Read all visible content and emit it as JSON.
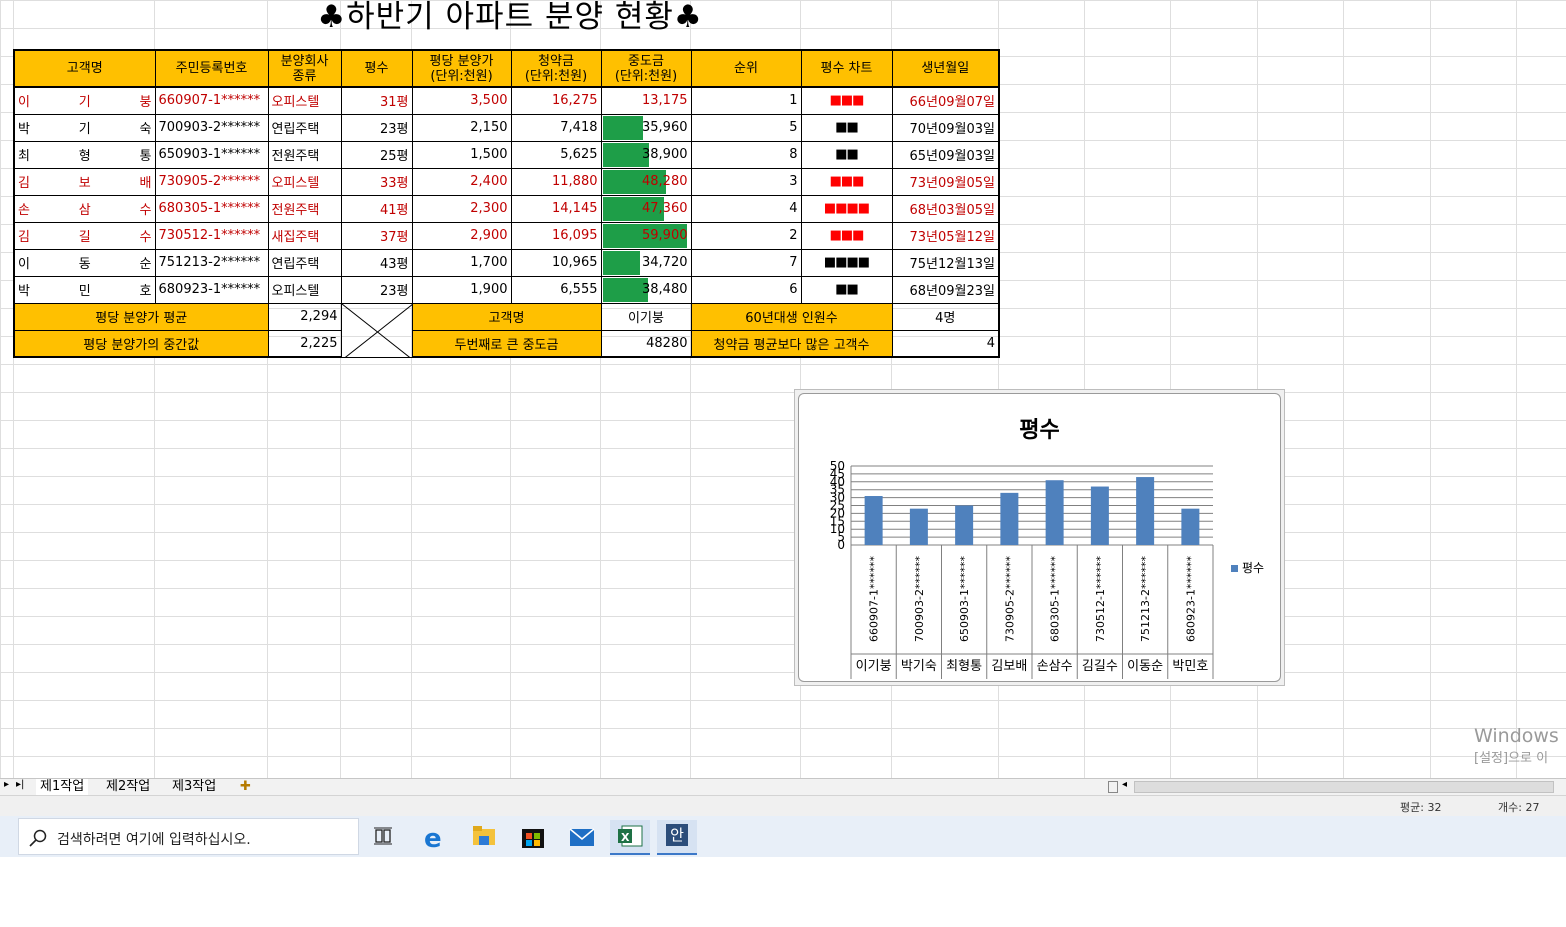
{
  "title": "♣하반기 아파트 분양 현황♣",
  "headers": [
    "고객명",
    "주민등록번호",
    "분양회사\n종류",
    "평수",
    "평당 분양가\n(단위:천원)",
    "청약금\n(단위:천원)",
    "중도금\n(단위:천원)",
    "순위",
    "평수 차트",
    "생년월일"
  ],
  "rows": [
    {
      "name": "이 기 붕",
      "id": "660907-1******",
      "type": "오피스텔",
      "size": "31평",
      "price": "3,500",
      "deposit": "16,275",
      "mid": "13,175",
      "mid_fill": 0.0,
      "rank": "1",
      "chart": "■■■",
      "birth": "66년09월07일",
      "red": true
    },
    {
      "name": "박 기 숙",
      "id": "700903-2******",
      "type": "연립주택",
      "size": "23평",
      "price": "2,150",
      "deposit": "7,418",
      "mid": "35,960",
      "mid_fill": 0.46,
      "rank": "5",
      "chart": "■■",
      "birth": "70년09월03일",
      "red": false
    },
    {
      "name": "최 형 통",
      "id": "650903-1******",
      "type": "전원주택",
      "size": "25평",
      "price": "1,500",
      "deposit": "5,625",
      "mid": "38,900",
      "mid_fill": 0.53,
      "rank": "8",
      "chart": "■■",
      "birth": "65년09월03일",
      "red": false
    },
    {
      "name": "김 보 배",
      "id": "730905-2******",
      "type": "오피스텔",
      "size": "33평",
      "price": "2,400",
      "deposit": "11,880",
      "mid": "48,280",
      "mid_fill": 0.73,
      "rank": "3",
      "chart": "■■■",
      "birth": "73년09월05일",
      "red": true
    },
    {
      "name": "손 삼 수",
      "id": "680305-1******",
      "type": "전원주택",
      "size": "41평",
      "price": "2,300",
      "deposit": "14,145",
      "mid": "47,360",
      "mid_fill": 0.71,
      "rank": "4",
      "chart": "■■■■",
      "birth": "68년03월05일",
      "red": true
    },
    {
      "name": "김 길 수",
      "id": "730512-1******",
      "type": "새집주택",
      "size": "37평",
      "price": "2,900",
      "deposit": "16,095",
      "mid": "59,900",
      "mid_fill": 0.98,
      "rank": "2",
      "chart": "■■■",
      "birth": "73년05월12일",
      "red": true
    },
    {
      "name": "이 동 순",
      "id": "751213-2******",
      "type": "연립주택",
      "size": "43평",
      "price": "1,700",
      "deposit": "10,965",
      "mid": "34,720",
      "mid_fill": 0.43,
      "rank": "7",
      "chart": "■■■■",
      "birth": "75년12월13일",
      "red": false
    },
    {
      "name": "박 민 호",
      "id": "680923-1******",
      "type": "오피스텔",
      "size": "23평",
      "price": "1,900",
      "deposit": "6,555",
      "mid": "38,480",
      "mid_fill": 0.52,
      "rank": "6",
      "chart": "■■",
      "birth": "68년09월23일",
      "red": false
    }
  ],
  "summary": {
    "avg_label": "평당 분양가 평균",
    "avg_value": "2,294",
    "median_label": "평당 분양가의 중간값",
    "median_value": "2,225",
    "cust_label": "고객명",
    "cust_value": "이기붕",
    "second_label": "두번째로 큰 중도금",
    "second_value": "48280",
    "sixties_label": "60년대생 인원수",
    "sixties_value": "4명",
    "above_label": "청약금 평균보다 많은 고객수",
    "above_value": "4"
  },
  "colors": {
    "header": "#ffc000",
    "red": "#c00000",
    "bar": "#1e9e48",
    "series": "#4f81bd"
  },
  "chart_data": {
    "type": "bar",
    "title": "평수",
    "categories": [
      [
        "660907-1******",
        "이기붕"
      ],
      [
        "700903-2******",
        "박기숙"
      ],
      [
        "650903-1******",
        "최형통"
      ],
      [
        "730905-2******",
        "김보배"
      ],
      [
        "680305-1******",
        "손삼수"
      ],
      [
        "730512-1******",
        "김길수"
      ],
      [
        "751213-2******",
        "이동순"
      ],
      [
        "680923-1******",
        "박민호"
      ]
    ],
    "series": [
      {
        "name": "평수",
        "values": [
          31,
          23,
          25,
          33,
          41,
          37,
          43,
          23
        ]
      }
    ],
    "ylim": [
      0,
      50
    ],
    "yticks": [
      0,
      5,
      10,
      15,
      20,
      25,
      30,
      35,
      40,
      45,
      50
    ],
    "legend": "right",
    "grid": true
  },
  "sheet_tabs": [
    "제1작업",
    "제2작업",
    "제3작업"
  ],
  "status": {
    "average": "평균: 32",
    "count": "개수: 27"
  },
  "taskbar": {
    "search_placeholder": "검색하려면 여기에 입력하십시오.",
    "ime": "안"
  },
  "watermark": {
    "line1": "Windows",
    "line2": "[설정]으로 이"
  }
}
